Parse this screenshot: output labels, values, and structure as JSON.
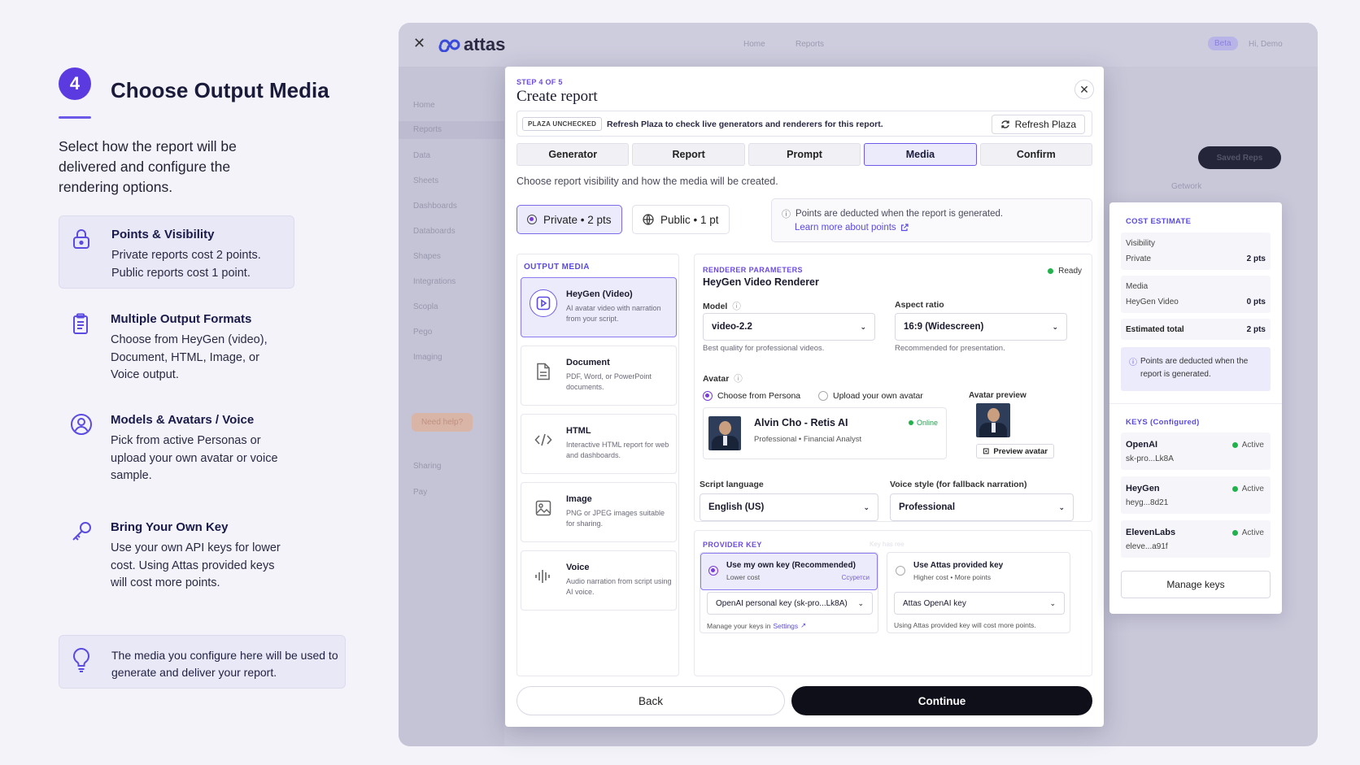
{
  "left": {
    "step_number": "4",
    "title": "Choose Output Media",
    "intro": "Select how the report will be delivered and configure the rendering options.",
    "features": [
      {
        "title": "Points & Visibility",
        "desc": "Private reports cost 2 points. Public reports cost 1 point.",
        "icon": "lock-icon"
      },
      {
        "title": "Multiple Output Formats",
        "desc": "Choose from HeyGen (video), Document, HTML, Image, or Voice output.",
        "icon": "clipboard-icon"
      },
      {
        "title": "Models & Avatars / Voice",
        "desc": "Pick from active Personas or upload your own avatar or voice sample.",
        "icon": "user-circle-icon"
      },
      {
        "title": "Bring Your Own Key",
        "desc": "Use your own API keys for lower cost. Using Attas provided keys will cost more points.",
        "icon": "key-icon"
      }
    ],
    "tip": "The media you configure here will be used to generate and deliver your report."
  },
  "app": {
    "logo": "attas",
    "nav": [
      "Home",
      "Reports"
    ],
    "badge": "Beta",
    "user": "Hi, Demo",
    "side": [
      "Home",
      "Reports",
      "Data",
      "Sheets",
      "Dashboards",
      "Databoards",
      "Shapes",
      "Integrations",
      "Scopla",
      "Pego",
      "Imaging"
    ],
    "side_bottom": [
      "Sharing",
      "Pay"
    ],
    "help": "Need help?",
    "bg_button": "Saved Reps",
    "bg_tab": "Getwork"
  },
  "modal": {
    "step": "STEP 4 OF 5",
    "title": "Create report",
    "plaza_badge": "PLAZA UNCHECKED",
    "plaza_text": "Refresh Plaza to check live generators and renderers for this report.",
    "refresh_label": "Refresh Plaza",
    "tabs": [
      "Generator",
      "Report",
      "Prompt",
      "Media",
      "Confirm"
    ],
    "subtitle": "Choose report visibility and how the media will be created.",
    "vis_private": "Private • 2 pts",
    "vis_public": "Public • 1 pt",
    "pts_note": "Points are deducted when the report is generated.",
    "pts_link": "Learn more about points",
    "output_media_header": "OUTPUT MEDIA",
    "media": [
      {
        "name": "HeyGen (Video)",
        "desc": "AI avatar video with narration from your script."
      },
      {
        "name": "Document",
        "desc": "PDF, Word, or PowerPoint documents."
      },
      {
        "name": "HTML",
        "desc": "Interactive HTML report for web and dashboards."
      },
      {
        "name": "Image",
        "desc": "PNG or JPEG images suitable for sharing."
      },
      {
        "name": "Voice",
        "desc": "Audio narration from script using AI voice."
      }
    ],
    "renderer": {
      "header": "RENDERER PARAMETERS",
      "name": "HeyGen Video Renderer",
      "status": "Ready",
      "model_label": "Model",
      "model_value": "video-2.2",
      "model_hint": "Best quality for professional videos.",
      "aspect_label": "Aspect ratio",
      "aspect_value": "16:9 (Widescreen)",
      "aspect_hint": "Recommended for presentation.",
      "avatar_label": "Avatar",
      "avatar_opt1": "Choose from Persona",
      "avatar_opt2": "Upload your own avatar",
      "avatar_preview_label": "Avatar preview",
      "persona_name": "Alvin Cho - Retis AI",
      "persona_status": "Online",
      "persona_role": "Professional • Financial Analyst",
      "preview_btn": "Preview avatar",
      "lang_label": "Script language",
      "lang_value": "English (US)",
      "voice_label": "Voice style (for fallback narration)",
      "voice_value": "Professional"
    },
    "provider": {
      "header": "PROVIDER KEY",
      "faint": "Key has ree",
      "own_title": "Use my own key (Recommended)",
      "own_sub": "Lower cost",
      "own_tag": "Ссуретси",
      "own_select": "OpenAI personal key (sk-pro...Lk8A)",
      "own_hint_pre": "Manage your keys in",
      "own_hint_link": "Settings",
      "attas_title": "Use Attas provided key",
      "attas_sub": "Higher cost • More points",
      "attas_select": "Attas OpenAI key",
      "attas_hint": "Using Attas provided key will cost more points."
    },
    "back": "Back",
    "continue": "Continue"
  },
  "cost": {
    "header": "COST ESTIMATE",
    "visibility_label": "Visibility",
    "visibility_key": "Private",
    "visibility_val": "2 pts",
    "media_label": "Media",
    "media_key": "HeyGen Video",
    "media_val": "0 pts",
    "total_label": "Estimated total",
    "total_val": "2 pts",
    "note": "Points are deducted when the report is generated.",
    "keys_header": "KEYS (Configured)",
    "keys": [
      {
        "name": "OpenAI",
        "value": "sk-pro...Lk8A",
        "status": "Active"
      },
      {
        "name": "HeyGen",
        "value": "heyg...8d21",
        "status": "Active"
      },
      {
        "name": "ElevenLabs",
        "value": "eleve...a91f",
        "status": "Active"
      }
    ],
    "manage": "Manage keys"
  },
  "colors": {
    "accent": "#5b3be0",
    "success": "#22b24c",
    "dark": "#0f0f1a"
  }
}
